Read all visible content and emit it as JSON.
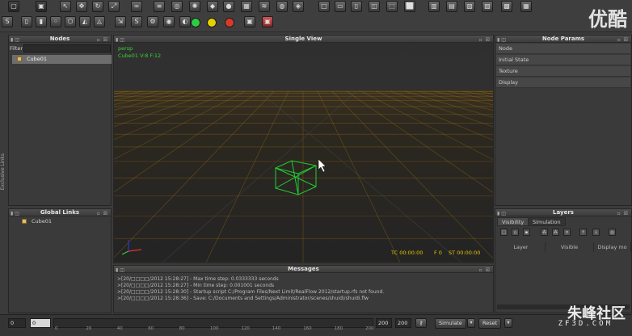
{
  "toolbar": {
    "icons_row1": [
      "new-scene-icon",
      "open-scene-icon",
      "save-scene-icon",
      "select-icon",
      "move-icon",
      "rotate-icon",
      "scale-icon",
      "link-icon",
      "layers-icon",
      "camera-icon",
      "emitter-icon",
      "object-icon",
      "sphere-icon",
      "mesh-icon",
      "daemon-icon",
      "fluid-icon",
      "render-icon",
      "view-front-icon",
      "view-side-icon",
      "view-top-icon",
      "view-perspective-icon",
      "layout-icon",
      "layout2-icon",
      "layout3-icon",
      "layout4-icon"
    ],
    "play_green": "#2ecc40",
    "play_yellow": "#e6d100",
    "play_red": "#d83a2a"
  },
  "nodes_panel": {
    "title": "Nodes",
    "filter_label": "Filter",
    "items": [
      "Cube01"
    ]
  },
  "global_links_panel": {
    "title": "Global Links",
    "items": [
      "Cube01"
    ]
  },
  "sidebar_vertical_label": "Exclusive Links",
  "viewport": {
    "title": "Single View",
    "camera_label": "persp",
    "object_info": "Cube01 V:8 F:12",
    "timecode": "TC 00:00:00",
    "frame": "F 0",
    "sim_time": "ST 00:00:00",
    "grid_color": "#b07a10",
    "cube_color": "#22cc33"
  },
  "messages_panel": {
    "title": "Messages",
    "lines": [
      ">[20/□□□□/2012 15:28:27] - Max time step: 0.0333333 seconds",
      ">[20/□□□□/2012 15:28:27] - Min time step: 0.001001 seconds",
      ">[20/□□□□/2012 15:28:30] - Startup script C:/Program Files/Next Limit/RealFlow 2012/startup.rfs not found.",
      ">[20/□□□□/2012 15:28:36] - Save: C:/Documents and Settings/Administrator/scenes/shuidi/shuidi.flw"
    ]
  },
  "node_params_panel": {
    "title": "Node Params",
    "sections": [
      "Node",
      "Initial State",
      "Texture",
      "Display"
    ]
  },
  "layers_panel": {
    "title": "Layers",
    "tabs": [
      "Visibility",
      "Simulation"
    ],
    "columns": [
      "Layer",
      "Visible",
      "Display mo"
    ]
  },
  "timeline": {
    "start": "0",
    "current": "0",
    "ticks": [
      "0",
      "20",
      "40",
      "60",
      "80",
      "100",
      "120",
      "140",
      "160",
      "180",
      "200"
    ],
    "end_a": "200",
    "end_b": "200",
    "simulate_label": "Simulate",
    "reset_label": "Reset"
  },
  "watermarks": {
    "top_right": "优酷",
    "bottom_right": "朱峰社区",
    "bottom_right_url": "ZF3D.COM"
  }
}
